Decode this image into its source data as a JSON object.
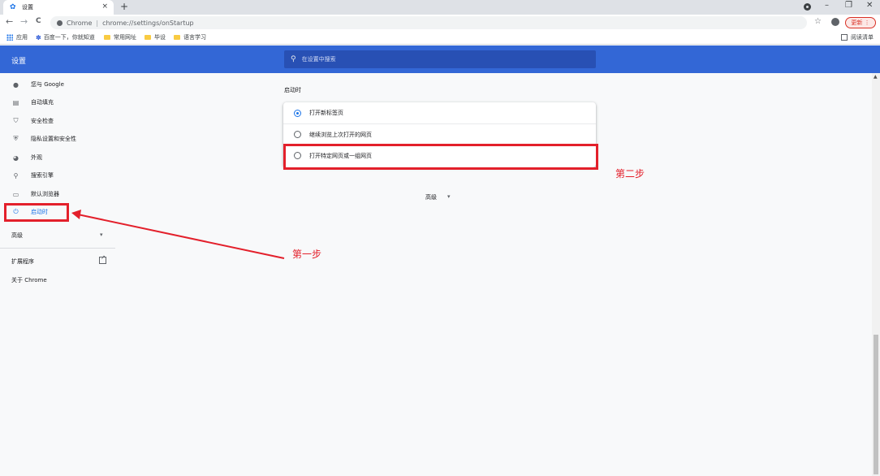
{
  "tab": {
    "title": "设置",
    "close": "×",
    "new_tab": "+"
  },
  "window_controls": {
    "minimize": "–",
    "restore": "❐",
    "close": "✕"
  },
  "toolbar": {
    "back": "←",
    "forward": "→",
    "reload": "C",
    "chrome_label": "Chrome",
    "separator": "|",
    "url": "chrome://settings/onStartup",
    "star": "☆",
    "update_label": "更新 ⋮"
  },
  "bookmarks": {
    "apps": "应用",
    "items": [
      "百度一下，你就知道",
      "常用网址",
      "毕设",
      "语言学习"
    ],
    "reading_list": "阅读清单"
  },
  "header": {
    "title": "设置",
    "search_placeholder": "在设置中搜索"
  },
  "sidebar": {
    "items": [
      {
        "label": "您与 Google",
        "icon": "person-icon"
      },
      {
        "label": "自动填充",
        "icon": "clipboard-icon"
      },
      {
        "label": "安全检查",
        "icon": "shield-check-icon"
      },
      {
        "label": "隐私设置和安全性",
        "icon": "shield-icon"
      },
      {
        "label": "外观",
        "icon": "palette-icon"
      },
      {
        "label": "搜索引擎",
        "icon": "search-icon"
      },
      {
        "label": "默认浏览器",
        "icon": "browser-icon"
      },
      {
        "label": "启动时",
        "icon": "power-icon"
      }
    ],
    "advanced": "高级",
    "advanced_arrow": "▾",
    "extensions": "扩展程序",
    "about": "关于 Chrome"
  },
  "main": {
    "section_title": "启动时",
    "options": [
      {
        "label": "打开新标签页",
        "checked": true
      },
      {
        "label": "继续浏览上次打开的网页",
        "checked": false
      },
      {
        "label": "打开特定网页或一组网页",
        "checked": false
      }
    ],
    "advanced": "高级",
    "advanced_arrow": "▾"
  },
  "annotations": {
    "step1": "第一步",
    "step2": "第二步",
    "color": "#e3202b"
  }
}
